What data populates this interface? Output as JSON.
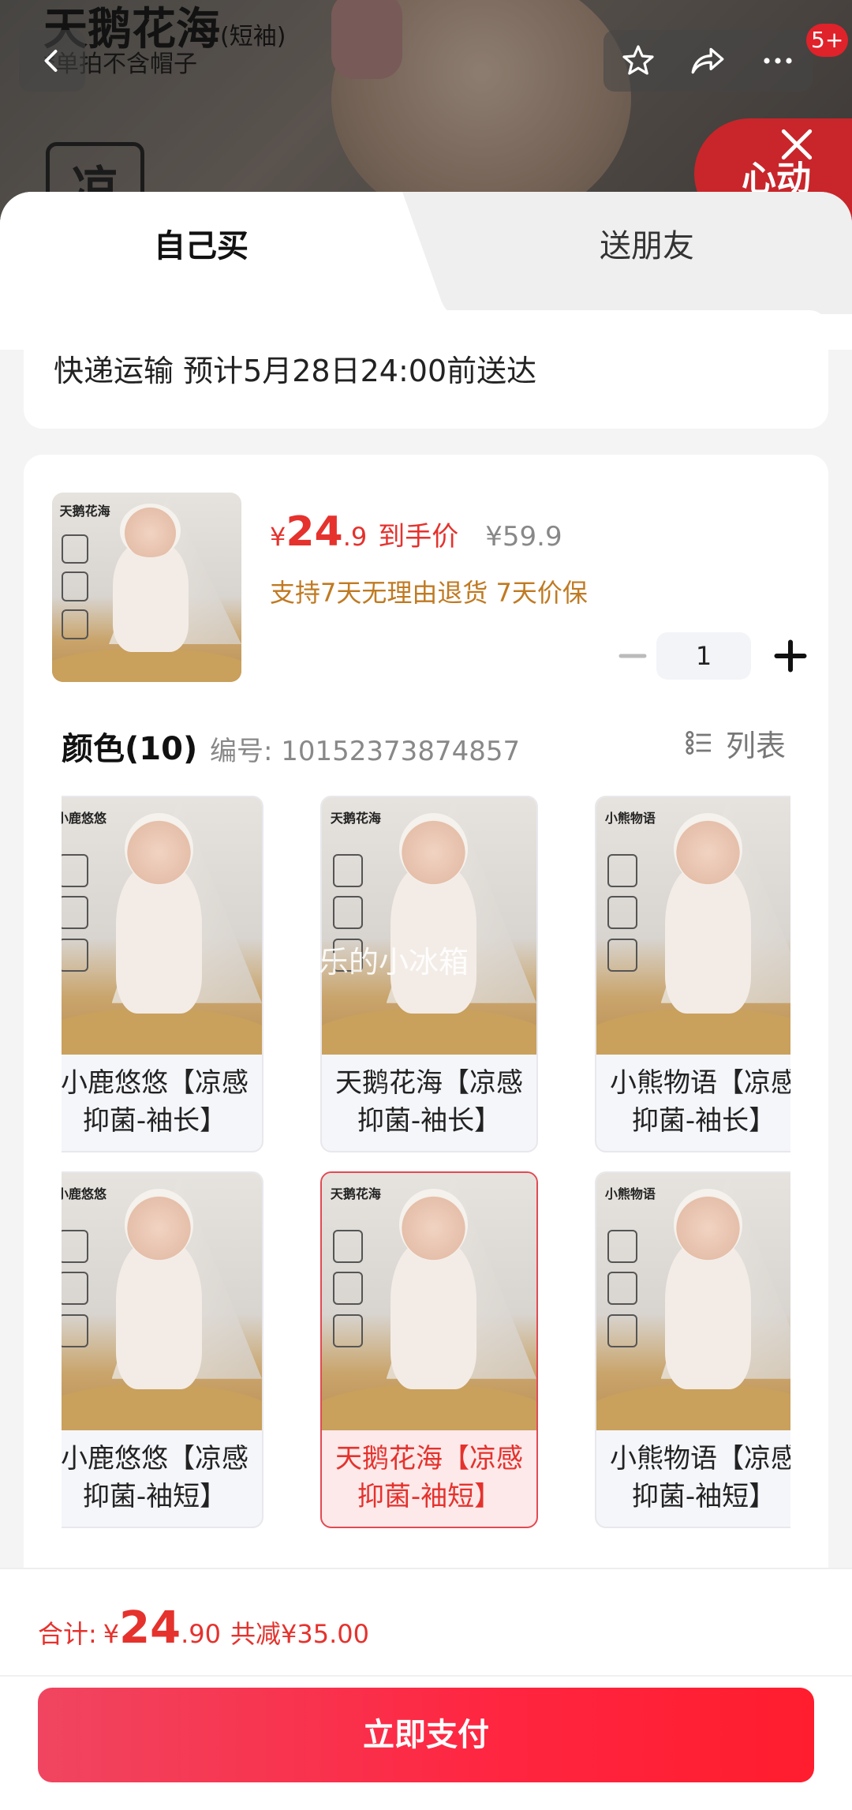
{
  "background": {
    "title": "天鹅花海",
    "title_suffix": "(短袖)",
    "subtitle": "*单拍不含帽子",
    "tag_text": "凉",
    "heart_text": "心动",
    "notification_count": "5+"
  },
  "tabs": {
    "self": "自己买",
    "gift": "送朋友"
  },
  "delivery": {
    "text": "快递运输 预计5月28日24:00前送达"
  },
  "product": {
    "thumb_label": "天鹅花海",
    "currency": "¥",
    "price_int": "24",
    "price_dec": ".9",
    "price_tag": "到手价",
    "original_price": "¥59.9",
    "service": "支持7天无理由退货 7天价保",
    "quantity": "1"
  },
  "colors": {
    "heading": "颜色(10)",
    "sku": "编号: 10152373874857",
    "list_toggle": "列表",
    "watermark": "快乐的小冰箱",
    "options": [
      {
        "label": "小鹿悠悠",
        "name": "小鹿悠悠【凉感抑菌-袖长】"
      },
      {
        "label": "天鹅花海",
        "name": "天鹅花海【凉感抑菌-袖长】"
      },
      {
        "label": "小熊物语",
        "name": "小熊物语【凉感抑菌-袖长】"
      },
      {
        "label": "小鹿悠悠",
        "name": "小鹿悠悠【凉感抑菌-袖短】"
      },
      {
        "label": "天鹅花海",
        "name": "天鹅花海【凉感抑菌-袖短】"
      },
      {
        "label": "小熊物语",
        "name": "小熊物语【凉感抑菌-袖短】"
      }
    ]
  },
  "footer": {
    "total_label": "合计:",
    "currency": "¥",
    "total_int": "24",
    "total_dec": ".90",
    "discount": "共减¥35.00",
    "pay_button": "立即支付"
  },
  "theme": {
    "accent": "#e5322d",
    "service": "#c07a22",
    "pay_start": "#f04560",
    "pay_end": "#ff1d2e"
  }
}
